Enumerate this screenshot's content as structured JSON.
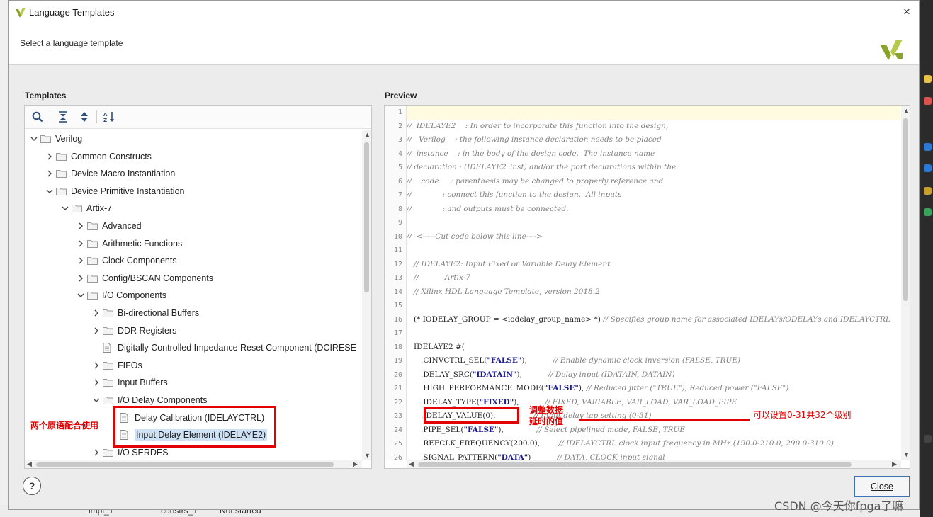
{
  "window": {
    "title": "Language Templates",
    "header_text": "Select a language template",
    "close_glyph": "×"
  },
  "templates": {
    "label": "Templates",
    "toolbar": [
      {
        "name": "search-icon"
      },
      {
        "name": "collapse-all-icon"
      },
      {
        "name": "expand-all-icon"
      },
      {
        "name": "sort-icon"
      }
    ],
    "tree": [
      {
        "label": "Verilog",
        "depth": 0,
        "state": "open",
        "kind": "folder"
      },
      {
        "label": "Common Constructs",
        "depth": 1,
        "state": "closed",
        "kind": "folder"
      },
      {
        "label": "Device Macro Instantiation",
        "depth": 1,
        "state": "closed",
        "kind": "folder"
      },
      {
        "label": "Device Primitive Instantiation",
        "depth": 1,
        "state": "open",
        "kind": "folder"
      },
      {
        "label": "Artix-7",
        "depth": 2,
        "state": "open",
        "kind": "folder"
      },
      {
        "label": "Advanced",
        "depth": 3,
        "state": "closed",
        "kind": "folder"
      },
      {
        "label": "Arithmetic Functions",
        "depth": 3,
        "state": "closed",
        "kind": "folder"
      },
      {
        "label": "Clock Components",
        "depth": 3,
        "state": "closed",
        "kind": "folder"
      },
      {
        "label": "Config/BSCAN Components",
        "depth": 3,
        "state": "closed",
        "kind": "folder"
      },
      {
        "label": "I/O Components",
        "depth": 3,
        "state": "open",
        "kind": "folder"
      },
      {
        "label": "Bi-directional Buffers",
        "depth": 4,
        "state": "closed",
        "kind": "folder"
      },
      {
        "label": "DDR Registers",
        "depth": 4,
        "state": "closed",
        "kind": "folder"
      },
      {
        "label": "Digitally Controlled Impedance Reset Component (DCIRESE",
        "depth": 4,
        "state": "leaf",
        "kind": "file"
      },
      {
        "label": "FIFOs",
        "depth": 4,
        "state": "closed",
        "kind": "folder"
      },
      {
        "label": "Input Buffers",
        "depth": 4,
        "state": "closed",
        "kind": "folder"
      },
      {
        "label": "I/O Delay Components",
        "depth": 4,
        "state": "open",
        "kind": "folder"
      },
      {
        "label": "Delay Calibration (IDELAYCTRL)",
        "depth": 5,
        "state": "leaf",
        "kind": "file"
      },
      {
        "label": "Input Delay Element (IDELAYE2)",
        "depth": 5,
        "state": "leaf",
        "kind": "file",
        "selected": true
      },
      {
        "label": "I/O SERDES",
        "depth": 4,
        "state": "closed",
        "kind": "folder"
      }
    ]
  },
  "preview": {
    "label": "Preview",
    "lines": [
      {
        "n": "1",
        "segs": [
          {
            "t": "",
            "c": "code"
          }
        ],
        "active": true
      },
      {
        "n": "2",
        "segs": [
          {
            "t": "//  IDELAYE2    : In order to incorporate this function into the design,",
            "c": "cmt"
          }
        ]
      },
      {
        "n": "3",
        "segs": [
          {
            "t": "//   Verilog    : the following instance declaration needs to be placed",
            "c": "cmt"
          }
        ]
      },
      {
        "n": "4",
        "segs": [
          {
            "t": "//  instance    : in the body of the design code.  The instance name",
            "c": "cmt"
          }
        ]
      },
      {
        "n": "5",
        "segs": [
          {
            "t": "// declaration : (IDELAYE2_inst) and/or the port declarations within the",
            "c": "cmt"
          }
        ]
      },
      {
        "n": "6",
        "segs": [
          {
            "t": "//    code     : parenthesis may be changed to properly reference and",
            "c": "cmt"
          }
        ]
      },
      {
        "n": "7",
        "segs": [
          {
            "t": "//             : connect this function to the design.  All inputs",
            "c": "cmt"
          }
        ]
      },
      {
        "n": "8",
        "segs": [
          {
            "t": "//             : and outputs must be connected.",
            "c": "cmt"
          }
        ]
      },
      {
        "n": "9",
        "segs": [
          {
            "t": "",
            "c": "code"
          }
        ]
      },
      {
        "n": "10",
        "segs": [
          {
            "t": "//  <-----Cut code below this line---->",
            "c": "cmt"
          }
        ]
      },
      {
        "n": "11",
        "segs": [
          {
            "t": "",
            "c": "code"
          }
        ]
      },
      {
        "n": "12",
        "segs": [
          {
            "t": "   // IDELAYE2: Input Fixed or Variable Delay Element",
            "c": "cmt"
          }
        ]
      },
      {
        "n": "13",
        "segs": [
          {
            "t": "   //           Artix-7",
            "c": "cmt"
          }
        ]
      },
      {
        "n": "14",
        "segs": [
          {
            "t": "   // Xilinx HDL Language Template, version 2018.2",
            "c": "cmt"
          }
        ]
      },
      {
        "n": "15",
        "segs": [
          {
            "t": "",
            "c": "code"
          }
        ]
      },
      {
        "n": "16",
        "segs": [
          {
            "t": "   (* IODELAY_GROUP = <iodelay_group_name> *) ",
            "c": "code"
          },
          {
            "t": "// Specifies group name for associated IDELAYs/ODELAYs and IDELAYCTRL",
            "c": "cmt"
          }
        ]
      },
      {
        "n": "17",
        "segs": [
          {
            "t": "",
            "c": "code"
          }
        ]
      },
      {
        "n": "18",
        "segs": [
          {
            "t": "   IDELAYE2 #(",
            "c": "code"
          }
        ]
      },
      {
        "n": "19",
        "segs": [
          {
            "t": "      .CINVCTRL_SEL(",
            "c": "code"
          },
          {
            "t": "\"FALSE\"",
            "c": "str"
          },
          {
            "t": "),           ",
            "c": "code"
          },
          {
            "t": "// Enable dynamic clock inversion (FALSE, TRUE)",
            "c": "cmt"
          }
        ]
      },
      {
        "n": "20",
        "segs": [
          {
            "t": "      .DELAY_SRC(",
            "c": "code"
          },
          {
            "t": "\"IDATAIN\"",
            "c": "str"
          },
          {
            "t": "),           ",
            "c": "code"
          },
          {
            "t": "// Delay input (IDATAIN, DATAIN)",
            "c": "cmt"
          }
        ]
      },
      {
        "n": "21",
        "segs": [
          {
            "t": "      .HIGH_PERFORMANCE_MODE(",
            "c": "code"
          },
          {
            "t": "\"FALSE\"",
            "c": "str"
          },
          {
            "t": "), ",
            "c": "code"
          },
          {
            "t": "// Reduced jitter (\"TRUE\"), Reduced power (\"FALSE\")",
            "c": "cmt"
          }
        ]
      },
      {
        "n": "22",
        "segs": [
          {
            "t": "      .IDELAY_TYPE(",
            "c": "code"
          },
          {
            "t": "\"FIXED\"",
            "c": "str"
          },
          {
            "t": "),           ",
            "c": "code"
          },
          {
            "t": "// FIXED, VARIABLE, VAR_LOAD, VAR_LOAD_PIPE",
            "c": "cmt"
          }
        ]
      },
      {
        "n": "23",
        "segs": [
          {
            "t": "      .IDELAY_VALUE(0),                ",
            "c": "code"
          },
          {
            "t": "// Input delay tap setting (0-31)",
            "c": "cmt"
          }
        ]
      },
      {
        "n": "24",
        "segs": [
          {
            "t": "      .PIPE_SEL(",
            "c": "code"
          },
          {
            "t": "\"FALSE\"",
            "c": "str"
          },
          {
            "t": "),              ",
            "c": "code"
          },
          {
            "t": "// Select pipelined mode, FALSE, TRUE",
            "c": "cmt"
          }
        ]
      },
      {
        "n": "25",
        "segs": [
          {
            "t": "      .REFCLK_FREQUENCY(200.0),        ",
            "c": "code"
          },
          {
            "t": "// IDELAYCTRL clock input frequency in MHz (190.0-210.0, 290.0-310.0).",
            "c": "cmt"
          }
        ]
      },
      {
        "n": "26",
        "segs": [
          {
            "t": "      .SIGNAL_PATTERN(",
            "c": "code"
          },
          {
            "t": "\"DATA\"",
            "c": "str"
          },
          {
            "t": ")           ",
            "c": "code"
          },
          {
            "t": "// DATA, CLOCK input signal",
            "c": "cmt"
          }
        ]
      }
    ]
  },
  "buttons": {
    "help": "?",
    "close": "Close"
  },
  "annotations": {
    "left_note": "两个原语配合使用",
    "middle_note_1": "调整数据",
    "middle_note_2": "延时的值",
    "right_note": "可以设置0-31共32个级别",
    "color": "#e30000"
  },
  "background": {
    "bottom_cells": [
      "impl_1",
      "constrs_1",
      "Not started"
    ]
  },
  "watermark": "CSDN @今天你fpga了嘛"
}
